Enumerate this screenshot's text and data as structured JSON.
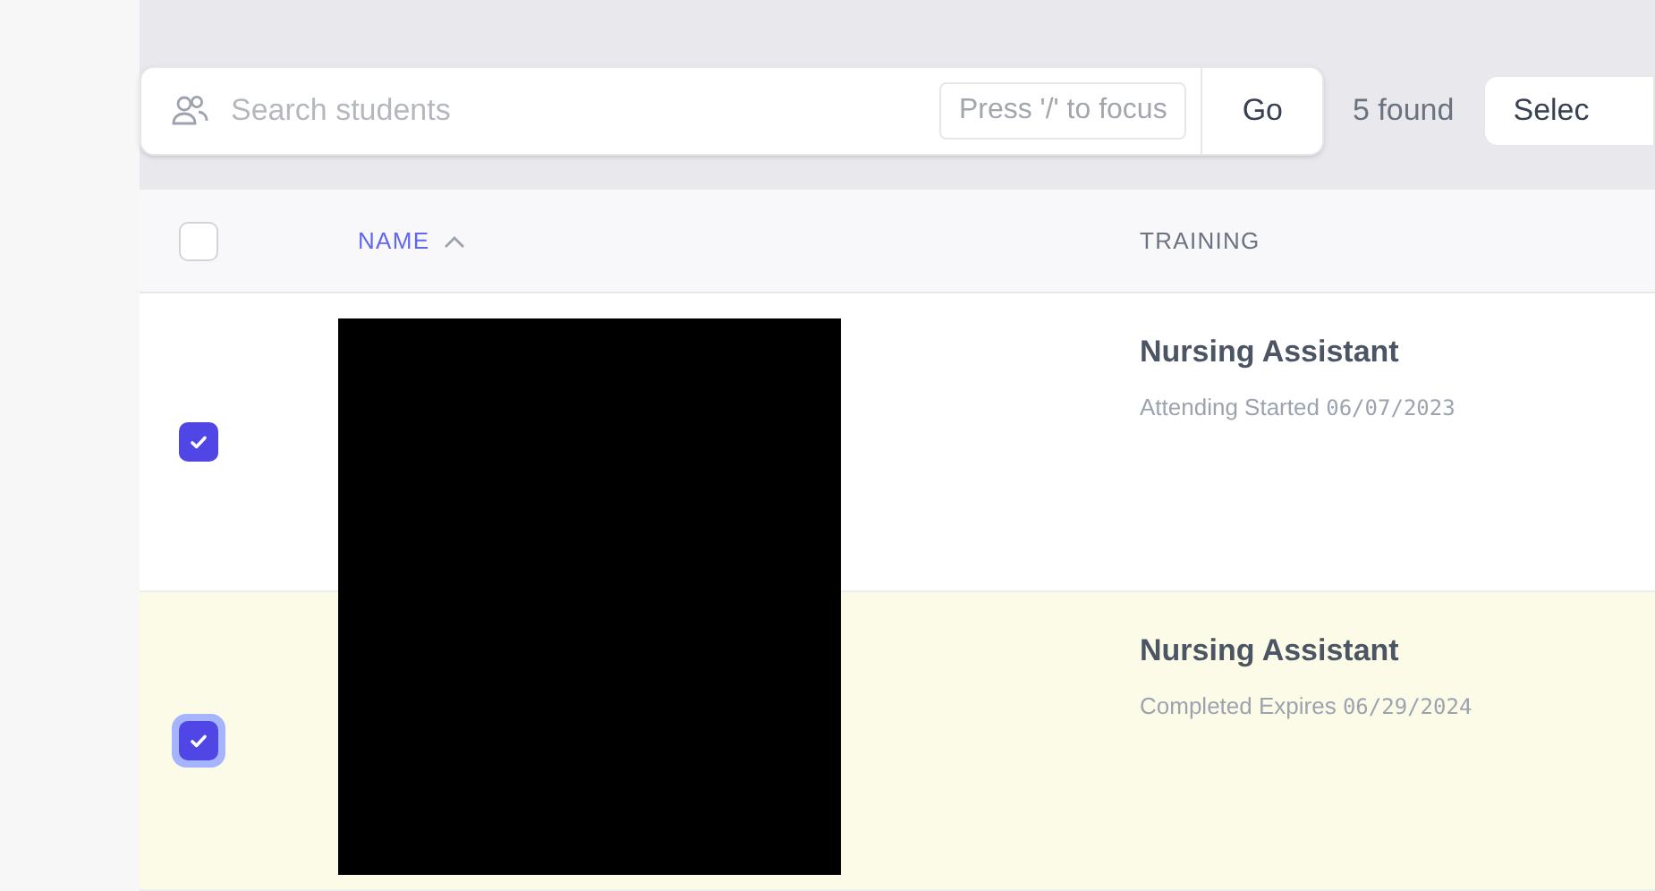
{
  "search": {
    "placeholder": "Search students",
    "shortcut_hint": "Press '/' to focus",
    "button": "Go"
  },
  "result_count": "5 found",
  "select_button": "Selec",
  "table": {
    "header_checkbox": {
      "checked": false
    },
    "columns": [
      {
        "label": "NAME",
        "sorted": true
      },
      {
        "label": "TRAINING",
        "sorted": false
      }
    ],
    "rows": [
      {
        "checked": true,
        "highlighted": false,
        "focused": false,
        "training": "Nursing Assistant",
        "detail": "Attending Started",
        "date": "06/07/2023"
      },
      {
        "checked": true,
        "highlighted": true,
        "focused": true,
        "training": "Nursing Assistant",
        "detail": "Completed Expires",
        "date": "06/29/2024"
      }
    ]
  }
}
